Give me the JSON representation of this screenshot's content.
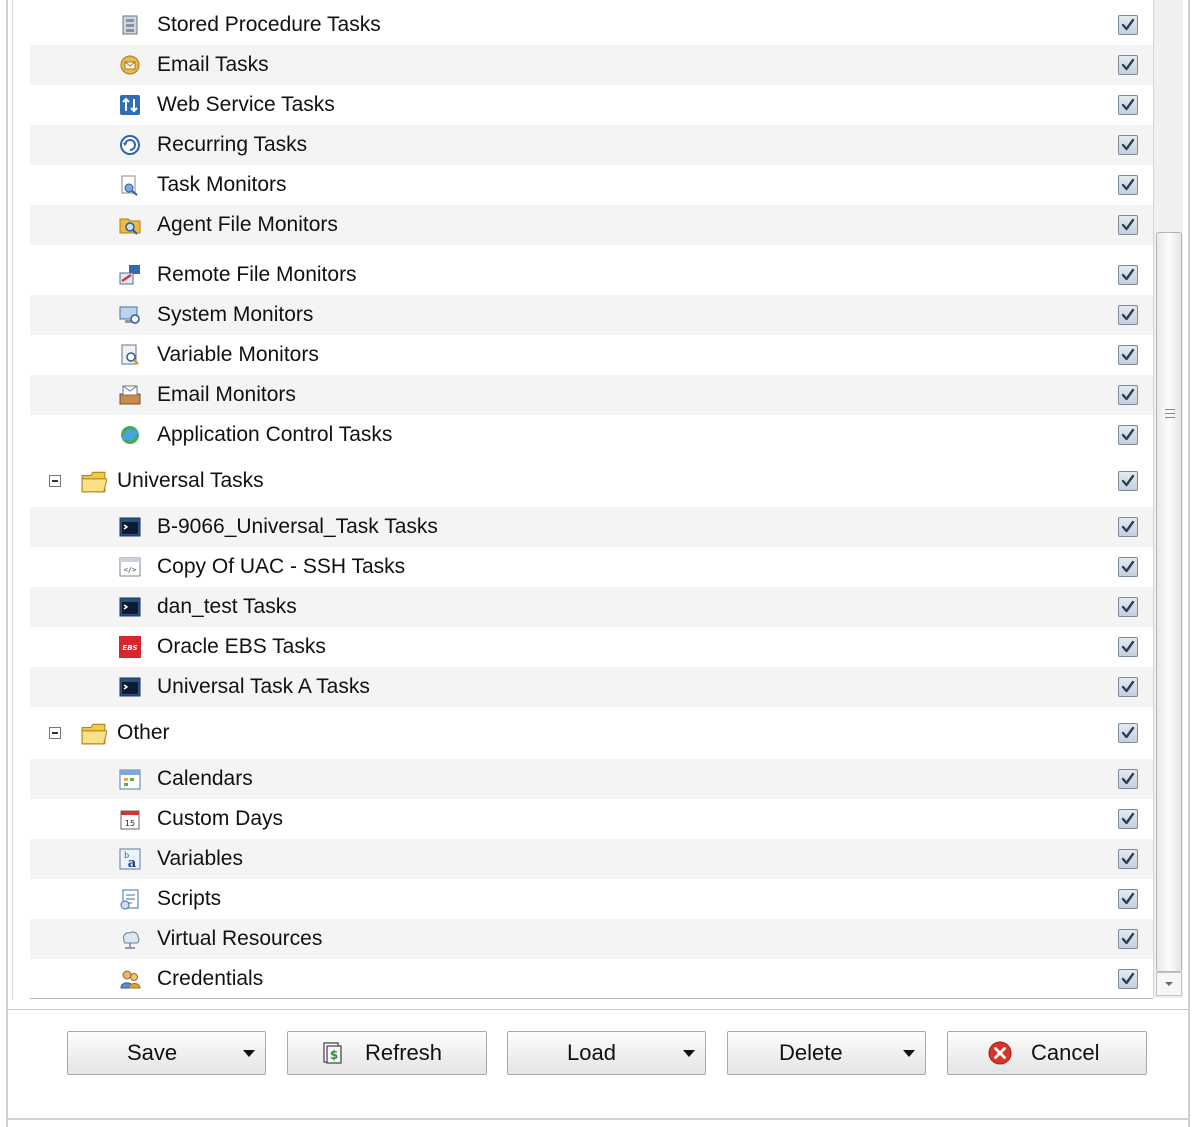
{
  "tree": {
    "items": [
      {
        "label": "Stored Procedure Tasks",
        "icon": "stored-procedure-icon",
        "checked": true,
        "level": "child"
      },
      {
        "label": "Email Tasks",
        "icon": "email-task-icon",
        "checked": true,
        "level": "child"
      },
      {
        "label": "Web Service Tasks",
        "icon": "web-service-icon",
        "checked": true,
        "level": "child"
      },
      {
        "label": "Recurring Tasks",
        "icon": "recurring-icon",
        "checked": true,
        "level": "child"
      },
      {
        "label": "Task Monitors",
        "icon": "task-monitor-icon",
        "checked": true,
        "level": "child"
      },
      {
        "label": "Agent File Monitors",
        "icon": "agent-file-monitor-icon",
        "checked": true,
        "level": "child"
      },
      {
        "label": "Remote File Monitors",
        "icon": "remote-file-monitor-icon",
        "checked": true,
        "level": "child"
      },
      {
        "label": "System Monitors",
        "icon": "system-monitor-icon",
        "checked": true,
        "level": "child"
      },
      {
        "label": "Variable Monitors",
        "icon": "variable-monitor-icon",
        "checked": true,
        "level": "child"
      },
      {
        "label": "Email Monitors",
        "icon": "email-monitor-icon",
        "checked": true,
        "level": "child"
      },
      {
        "label": "Application Control Tasks",
        "icon": "application-control-icon",
        "checked": true,
        "level": "child"
      },
      {
        "label": "Universal Tasks",
        "icon": "folder-icon",
        "checked": true,
        "level": "group"
      },
      {
        "label": "B-9066_Universal_Task Tasks",
        "icon": "terminal-icon",
        "checked": true,
        "level": "child"
      },
      {
        "label": "Copy Of UAC - SSH Tasks",
        "icon": "code-window-icon",
        "checked": true,
        "level": "child"
      },
      {
        "label": "dan_test Tasks",
        "icon": "terminal-icon",
        "checked": true,
        "level": "child"
      },
      {
        "label": "Oracle EBS Tasks",
        "icon": "ebs-icon",
        "checked": true,
        "level": "child",
        "icon_text": "EBS"
      },
      {
        "label": "Universal Task A Tasks",
        "icon": "terminal-icon",
        "checked": true,
        "level": "child"
      },
      {
        "label": "Other",
        "icon": "folder-icon",
        "checked": true,
        "level": "group"
      },
      {
        "label": "Calendars",
        "icon": "calendar-icon",
        "checked": true,
        "level": "child"
      },
      {
        "label": "Custom Days",
        "icon": "custom-day-icon",
        "checked": true,
        "level": "child",
        "icon_text": "15"
      },
      {
        "label": "Variables",
        "icon": "variable-icon",
        "checked": true,
        "level": "child",
        "icon_text": "a"
      },
      {
        "label": "Scripts",
        "icon": "script-icon",
        "checked": true,
        "level": "child"
      },
      {
        "label": "Virtual Resources",
        "icon": "virtual-resource-icon",
        "checked": true,
        "level": "child"
      },
      {
        "label": "Credentials",
        "icon": "credentials-icon",
        "checked": true,
        "level": "child"
      }
    ]
  },
  "toolbar": {
    "save_label": "Save",
    "refresh_label": "Refresh",
    "load_label": "Load",
    "delete_label": "Delete",
    "cancel_label": "Cancel"
  },
  "colors": {
    "row_alt": "#f4f4f4",
    "folder": "#f2c94c",
    "cancel_red": "#d9342b",
    "checkbox_border": "#7b8a9c"
  }
}
